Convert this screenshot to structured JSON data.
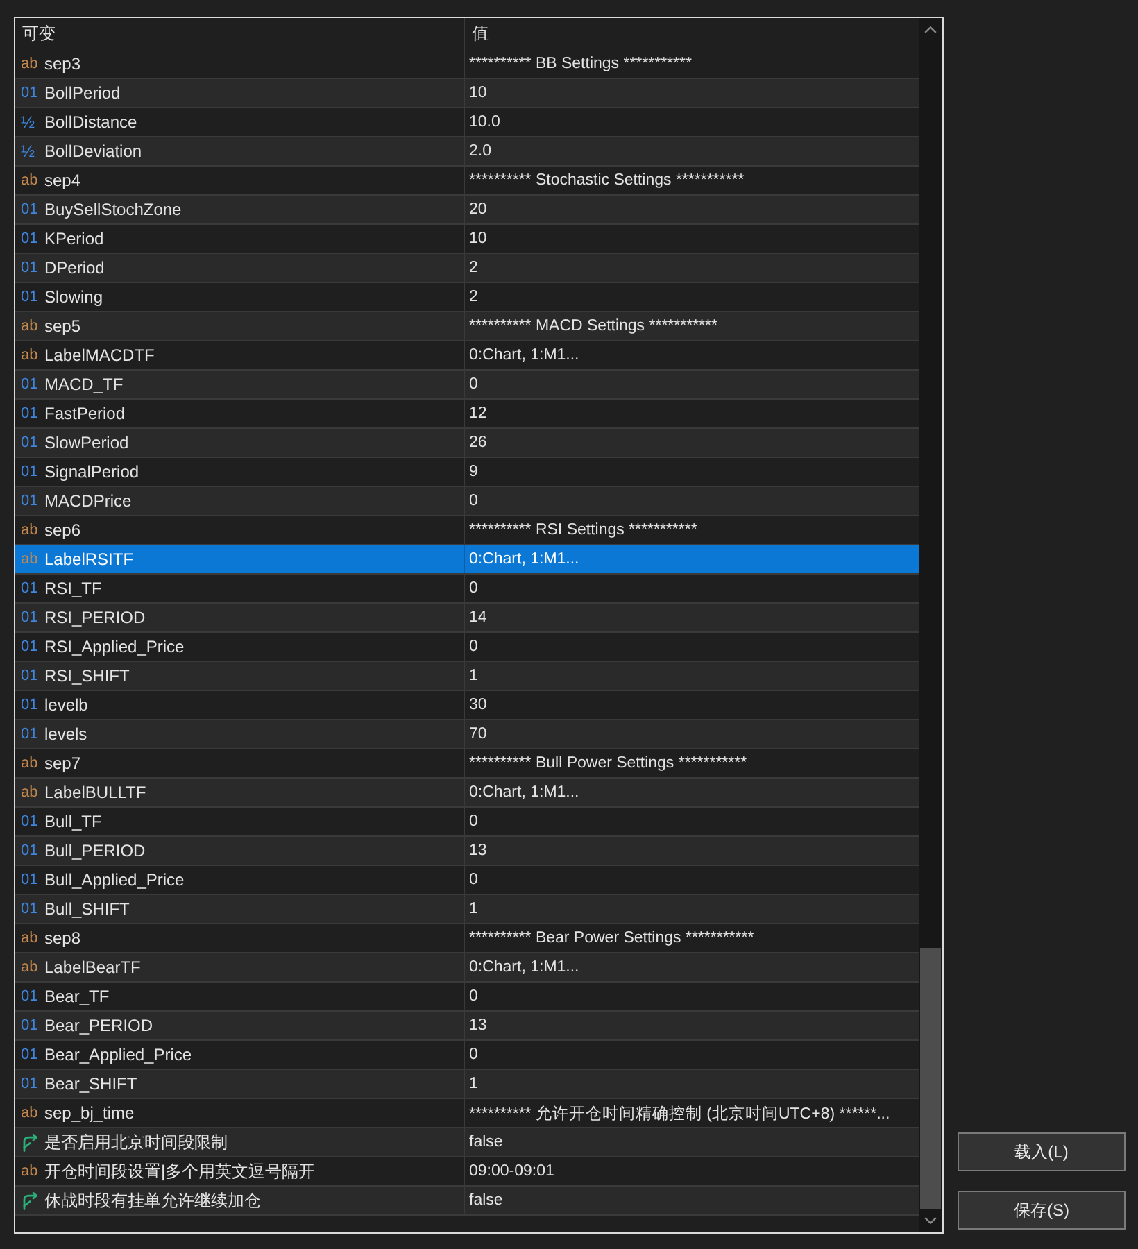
{
  "table": {
    "columns": [
      "可变",
      "值"
    ],
    "rows": [
      {
        "kind": "string",
        "type_icon": "ab",
        "name": "sep3",
        "value": "********** BB Settings ***********",
        "selected": false
      },
      {
        "kind": "int",
        "type_icon": "01",
        "name": "BollPeriod",
        "value": "10",
        "selected": false
      },
      {
        "kind": "double",
        "type_icon": "½",
        "name": "BollDistance",
        "value": "10.0",
        "selected": false
      },
      {
        "kind": "double",
        "type_icon": "½",
        "name": "BollDeviation",
        "value": "2.0",
        "selected": false
      },
      {
        "kind": "string",
        "type_icon": "ab",
        "name": "sep4",
        "value": "********** Stochastic Settings ***********",
        "selected": false
      },
      {
        "kind": "int",
        "type_icon": "01",
        "name": "BuySellStochZone",
        "value": "20",
        "selected": false
      },
      {
        "kind": "int",
        "type_icon": "01",
        "name": "KPeriod",
        "value": "10",
        "selected": false
      },
      {
        "kind": "int",
        "type_icon": "01",
        "name": "DPeriod",
        "value": "2",
        "selected": false
      },
      {
        "kind": "int",
        "type_icon": "01",
        "name": "Slowing",
        "value": "2",
        "selected": false
      },
      {
        "kind": "string",
        "type_icon": "ab",
        "name": "sep5",
        "value": "********** MACD Settings ***********",
        "selected": false
      },
      {
        "kind": "string",
        "type_icon": "ab",
        "name": "LabelMACDTF",
        "value": "0:Chart, 1:M1...",
        "selected": false
      },
      {
        "kind": "int",
        "type_icon": "01",
        "name": "MACD_TF",
        "value": "0",
        "selected": false
      },
      {
        "kind": "int",
        "type_icon": "01",
        "name": "FastPeriod",
        "value": "12",
        "selected": false
      },
      {
        "kind": "int",
        "type_icon": "01",
        "name": "SlowPeriod",
        "value": "26",
        "selected": false
      },
      {
        "kind": "int",
        "type_icon": "01",
        "name": "SignalPeriod",
        "value": "9",
        "selected": false
      },
      {
        "kind": "int",
        "type_icon": "01",
        "name": "MACDPrice",
        "value": "0",
        "selected": false
      },
      {
        "kind": "string",
        "type_icon": "ab",
        "name": "sep6",
        "value": "********** RSI Settings ***********",
        "selected": false
      },
      {
        "kind": "string",
        "type_icon": "ab",
        "name": "LabelRSITF",
        "value": "0:Chart, 1:M1...",
        "selected": true
      },
      {
        "kind": "int",
        "type_icon": "01",
        "name": "RSI_TF",
        "value": "0",
        "selected": false
      },
      {
        "kind": "int",
        "type_icon": "01",
        "name": "RSI_PERIOD",
        "value": "14",
        "selected": false
      },
      {
        "kind": "int",
        "type_icon": "01",
        "name": "RSI_Applied_Price",
        "value": "0",
        "selected": false
      },
      {
        "kind": "int",
        "type_icon": "01",
        "name": "RSI_SHIFT",
        "value": "1",
        "selected": false
      },
      {
        "kind": "int",
        "type_icon": "01",
        "name": "levelb",
        "value": "30",
        "selected": false
      },
      {
        "kind": "int",
        "type_icon": "01",
        "name": "levels",
        "value": "70",
        "selected": false
      },
      {
        "kind": "string",
        "type_icon": "ab",
        "name": "sep7",
        "value": "********** Bull Power Settings ***********",
        "selected": false
      },
      {
        "kind": "string",
        "type_icon": "ab",
        "name": "LabelBULLTF",
        "value": "0:Chart, 1:M1...",
        "selected": false
      },
      {
        "kind": "int",
        "type_icon": "01",
        "name": "Bull_TF",
        "value": "0",
        "selected": false
      },
      {
        "kind": "int",
        "type_icon": "01",
        "name": "Bull_PERIOD",
        "value": "13",
        "selected": false
      },
      {
        "kind": "int",
        "type_icon": "01",
        "name": "Bull_Applied_Price",
        "value": "0",
        "selected": false
      },
      {
        "kind": "int",
        "type_icon": "01",
        "name": "Bull_SHIFT",
        "value": "1",
        "selected": false
      },
      {
        "kind": "string",
        "type_icon": "ab",
        "name": "sep8",
        "value": "********** Bear Power Settings ***********",
        "selected": false
      },
      {
        "kind": "string",
        "type_icon": "ab",
        "name": "LabelBearTF",
        "value": "0:Chart, 1:M1...",
        "selected": false
      },
      {
        "kind": "int",
        "type_icon": "01",
        "name": "Bear_TF",
        "value": "0",
        "selected": false
      },
      {
        "kind": "int",
        "type_icon": "01",
        "name": "Bear_PERIOD",
        "value": "13",
        "selected": false
      },
      {
        "kind": "int",
        "type_icon": "01",
        "name": "Bear_Applied_Price",
        "value": "0",
        "selected": false
      },
      {
        "kind": "int",
        "type_icon": "01",
        "name": "Bear_SHIFT",
        "value": "1",
        "selected": false
      },
      {
        "kind": "string",
        "type_icon": "ab",
        "name": "sep_bj_time",
        "value": "********** 允许开仓时间精确控制 (北京时间UTC+8) ******...",
        "selected": false
      },
      {
        "kind": "bool",
        "name": "是否启用北京时间段限制",
        "value": "false",
        "selected": false
      },
      {
        "kind": "string",
        "type_icon": "ab",
        "name": "开仓时间段设置|多个用英文逗号隔开",
        "value": "09:00-09:01",
        "selected": false
      },
      {
        "kind": "bool",
        "name": "休战时段有挂单允许继续加仓",
        "value": "false",
        "selected": false
      }
    ]
  },
  "buttons": [
    {
      "label": "载入(L)"
    },
    {
      "label": "保存(S)"
    }
  ]
}
